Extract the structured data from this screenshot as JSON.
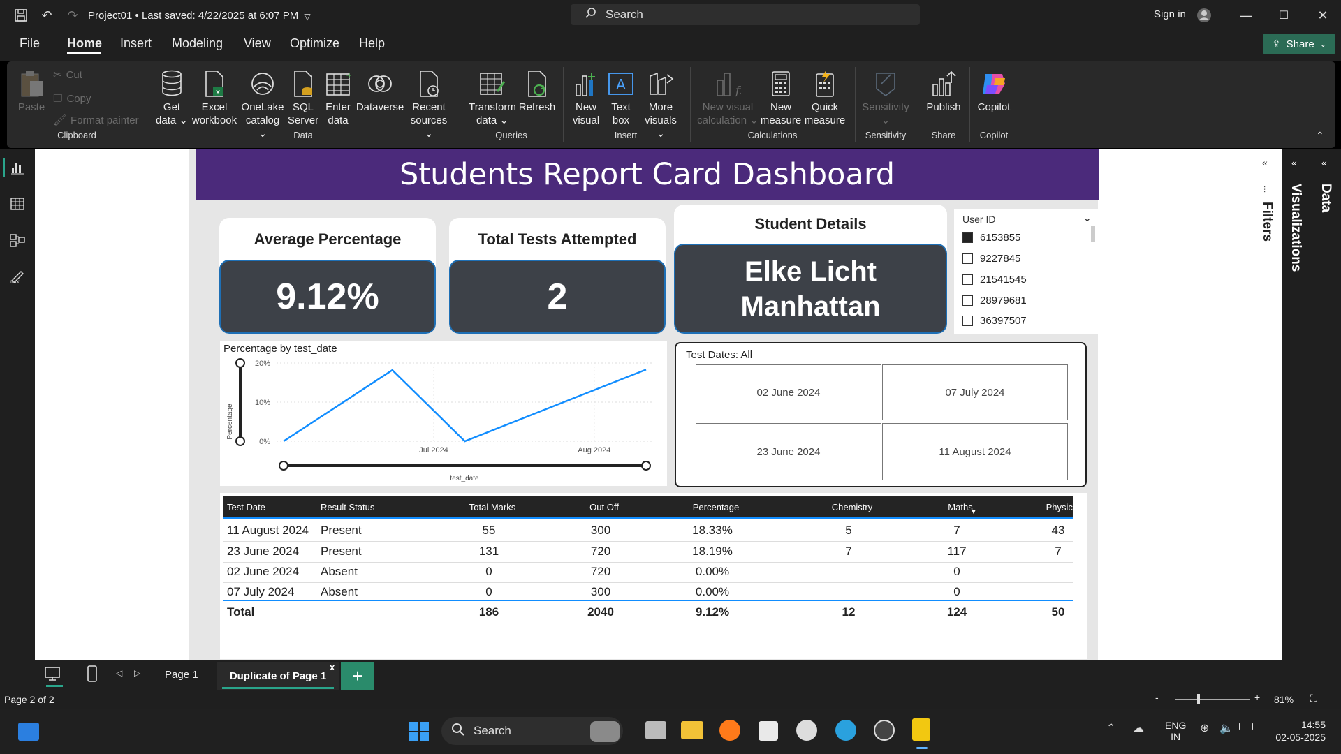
{
  "titlebar": {
    "project": "Project01 • Last saved: 4/22/2025 at 6:07 PM",
    "search": "Search",
    "sign_in": "Sign in"
  },
  "menu": {
    "items": [
      "File",
      "Home",
      "Insert",
      "Modeling",
      "View",
      "Optimize",
      "Help"
    ],
    "share": "Share"
  },
  "ribbon": {
    "clipboard": {
      "paste": "Paste",
      "cut": "Cut",
      "copy": "Copy",
      "format_painter": "Format painter",
      "group": "Clipboard"
    },
    "data": {
      "get_data": [
        "Get",
        "data"
      ],
      "excel": [
        "Excel",
        "workbook"
      ],
      "onelake": [
        "OneLake",
        "catalog"
      ],
      "sql": [
        "SQL",
        "Server"
      ],
      "enter": [
        "Enter",
        "data"
      ],
      "dataverse": [
        "Dataverse"
      ],
      "recent": [
        "Recent",
        "sources"
      ],
      "group": "Data"
    },
    "queries": {
      "transform": [
        "Transform",
        "data"
      ],
      "refresh": [
        "Refresh"
      ],
      "group": "Queries"
    },
    "insert": {
      "new_visual": [
        "New",
        "visual"
      ],
      "text_box": [
        "Text",
        "box"
      ],
      "more_visuals": [
        "More",
        "visuals"
      ],
      "group": "Insert"
    },
    "calculations": {
      "new_visual_calc": [
        "New visual",
        "calculation"
      ],
      "new_measure": [
        "New",
        "measure"
      ],
      "quick_measure": [
        "Quick",
        "measure"
      ],
      "group": "Calculations"
    },
    "sensitivity": {
      "label": [
        "Sensitivity"
      ],
      "group": "Sensitivity"
    },
    "share": {
      "publish": [
        "Publish"
      ],
      "group": "Share"
    },
    "copilot": {
      "label": [
        "Copilot"
      ],
      "group": "Copilot"
    }
  },
  "dashboard": {
    "title": "Students Report Card Dashboard",
    "avg_card": {
      "title": "Average Percentage",
      "value": "9.12%"
    },
    "tests_card": {
      "title": "Total Tests Attempted",
      "value": "2"
    },
    "student_card": {
      "title": "Student Details",
      "name": "Elke Licht",
      "city": "Manhattan"
    },
    "slicer": {
      "title": "User ID",
      "items": [
        {
          "id": "6153855",
          "checked": true
        },
        {
          "id": "9227845",
          "checked": false
        },
        {
          "id": "21541545",
          "checked": false
        },
        {
          "id": "28979681",
          "checked": false
        },
        {
          "id": "36397507",
          "checked": false
        }
      ]
    },
    "dates_slicer": {
      "title": "Test Dates: All",
      "tiles": [
        "02 June 2024",
        "07 July 2024",
        "23 June 2024",
        "11 August 2024"
      ]
    }
  },
  "chart_data": {
    "type": "line",
    "title": "Percentage by test_date",
    "xlabel": "test_date",
    "ylabel": "Percentage",
    "x_ticks": [
      "Jul 2024",
      "Aug 2024"
    ],
    "y_ticks": [
      "0%",
      "10%",
      "20%"
    ],
    "ylim": [
      0,
      20
    ],
    "x": [
      "02 June 2024",
      "23 June 2024",
      "07 July 2024",
      "11 August 2024"
    ],
    "series": [
      {
        "values": [
          0.0,
          18.19,
          0.0,
          18.33
        ],
        "color": "#118dff"
      }
    ]
  },
  "table": {
    "headers": [
      "Test Date",
      "Result Status",
      "Total Marks",
      "Out Off",
      "Percentage",
      "Chemistry",
      "Maths",
      "Physics"
    ],
    "rows": [
      [
        "11 August 2024",
        "Present",
        "55",
        "300",
        "18.33%",
        "5",
        "7",
        "43"
      ],
      [
        "23 June 2024",
        "Present",
        "131",
        "720",
        "18.19%",
        "7",
        "117",
        "7"
      ],
      [
        "02 June 2024",
        "Absent",
        "0",
        "720",
        "0.00%",
        "",
        "0",
        ""
      ],
      [
        "07 July 2024",
        "Absent",
        "0",
        "300",
        "0.00%",
        "",
        "0",
        ""
      ]
    ],
    "total": [
      "Total",
      "",
      "186",
      "2040",
      "9.12%",
      "12",
      "124",
      "50"
    ]
  },
  "panes": {
    "filters": "Filters",
    "visualizations": "Visualizations",
    "data": "Data"
  },
  "pagetabs": {
    "page1": "Page 1",
    "dup": "Duplicate of Page 1",
    "close": "x",
    "add": "+"
  },
  "status": {
    "page": "Page 2 of 2",
    "zoom": "81%"
  },
  "taskbar": {
    "search": "Search",
    "lang1": "ENG",
    "lang2": "IN",
    "time": "14:55",
    "date": "02-05-2025"
  },
  "colors": {
    "accent": "#2a8b6b",
    "header": "#4b2a7b",
    "line": "#118dff",
    "card_body": "#3d4148"
  }
}
